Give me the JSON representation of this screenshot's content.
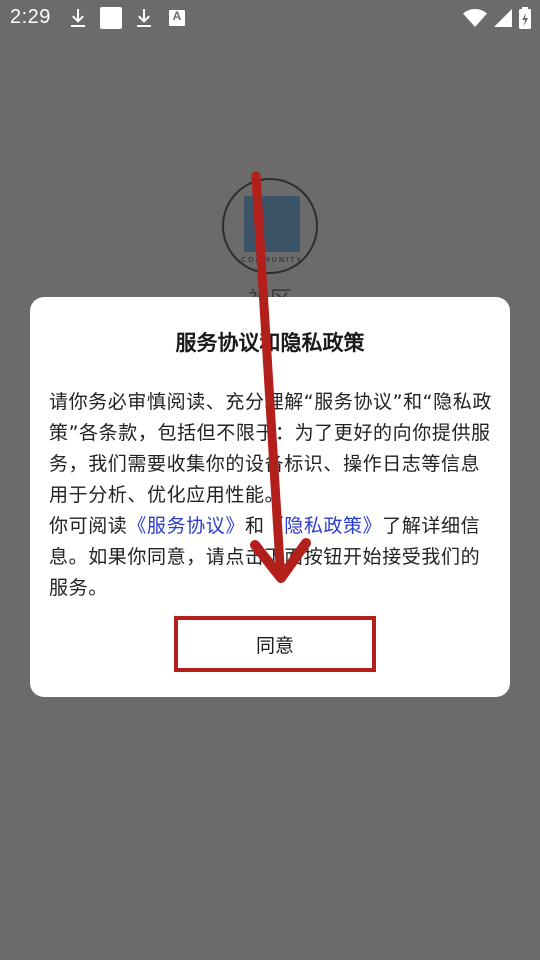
{
  "status_bar": {
    "time": "2:29",
    "left_icons": [
      "download-icon",
      "white-square-icon",
      "download-icon",
      "text-a-icon"
    ],
    "right_icons": [
      "wifi-icon",
      "cell-signal-icon",
      "battery-icon"
    ],
    "text_icon_letter": "A"
  },
  "background_app": {
    "logo_text": "COMMUNITY",
    "app_name": "社区"
  },
  "dialog": {
    "title": "服务协议和隐私政策",
    "body_part1": "请你务必审慎阅读、充分理解“服务协议”和“隐私政策”各条款，包括但不限于：为了更好的向你提供服务，我们需要收集你的设备标识、操作日志等信息用于分析、优化应用性能。",
    "body_part2_prefix": "你可阅读",
    "service_link": "《服务协议》",
    "and_text": "和",
    "privacy_link": "《隐私政策》",
    "body_part2_suffix": "了解详细信息。如果你同意，请点击下面按钮开始接受我们的服务。",
    "agree_button": "同意"
  },
  "colors": {
    "overlay": "#6b6b6b",
    "link": "#2a3bd0",
    "annotation_red": "#b3201c"
  }
}
